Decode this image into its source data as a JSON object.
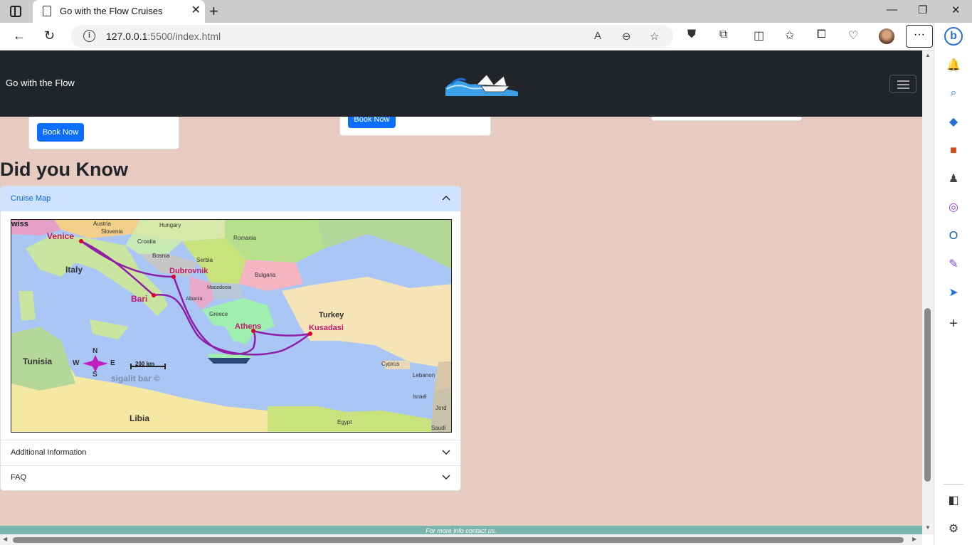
{
  "browser": {
    "tab_title": "Go with the Flow Cruises",
    "tab_close": "✕",
    "new_tab": "+",
    "url_host": "127.0.0.1",
    "url_rest": ":5500/index.html",
    "window_controls": [
      "—",
      "❐",
      "✕"
    ]
  },
  "page": {
    "brand": "Go with the Flow",
    "book_now_1": "Book Now",
    "book_now_2": "Book Now",
    "section_title": "Did you Know",
    "accordion": {
      "item1": "Cruise Map",
      "item2": "Additional Information",
      "item3": "FAQ"
    },
    "footer": "For more info contact us."
  },
  "map": {
    "places": {
      "venice": "Venice",
      "dubrovnik": "Dubrovnik",
      "bari": "Bari",
      "athens": "Athens",
      "kusadasi": "Kusadasi",
      "italy": "Italy",
      "greece": "Greece",
      "turkey": "Turkey",
      "tunisia": "Tunisia",
      "libia": "Libia",
      "egypt": "Egypt",
      "cyprus": "Cyprus",
      "lebanon": "Lebanon",
      "israel": "Israel",
      "jordan": "Jord",
      "saudi": "Saudi",
      "swiss": "wiss",
      "austria": "Austria",
      "hungary": "Hungary",
      "slovenia": "Slovenia",
      "croatia": "Croatia",
      "bosnia": "Bosnia",
      "serbia": "Serbia",
      "romania": "Romania",
      "bulgaria": "Bulgaria",
      "macedonia": "Macedonia",
      "albania": "Albania"
    },
    "compass": {
      "n": "N",
      "s": "S",
      "e": "E",
      "w": "W"
    },
    "scale": "200 km",
    "credit": "sigalit bar ©"
  },
  "colors": {
    "page_bg": "#e8cbc0",
    "navbar": "#212529",
    "primary": "#0d6efd",
    "accordion_active": "#cfe2ff",
    "footer": "#79b5ae",
    "route": "#8e1fa8",
    "city_label": "#c2186a"
  }
}
